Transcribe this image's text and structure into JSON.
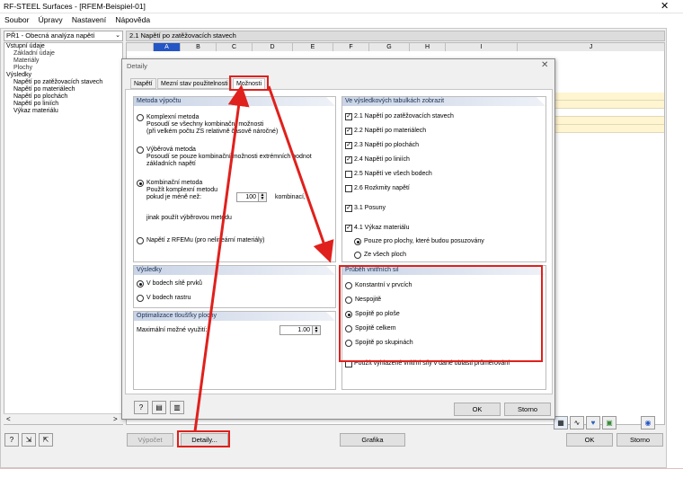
{
  "window": {
    "title": "RF-STEEL Surfaces - [RFEM-Beispiel-01]",
    "close_glyph": "✕"
  },
  "menu": [
    "Soubor",
    "Úpravy",
    "Nastavení",
    "Nápověda"
  ],
  "case_combo": {
    "value": "PŘ1 - Obecná analýza napětí",
    "arrow": "⌄"
  },
  "table_title": "2.1 Napětí po zatěžovacích stavech",
  "nav_tree": [
    {
      "label": "Vstupní údaje",
      "level": 0
    },
    {
      "label": "Základní údaje",
      "level": 1
    },
    {
      "label": "Materiály",
      "level": 1
    },
    {
      "label": "Plochy",
      "level": 1
    },
    {
      "label": "Výsledky",
      "level": 0
    },
    {
      "label": "Napětí po zatěžovacích stavech",
      "level": 1
    },
    {
      "label": "Napětí po materiálech",
      "level": 1
    },
    {
      "label": "Napětí po plochách",
      "level": 1
    },
    {
      "label": "Napětí po liniích",
      "level": 1
    },
    {
      "label": "Výkaz materiálu",
      "level": 1
    }
  ],
  "grid_columns": [
    "A",
    "B",
    "C",
    "D",
    "E",
    "F",
    "G",
    "H",
    "I",
    "J"
  ],
  "nav_scroll": {
    "left": "<",
    "right": ">"
  },
  "dialog": {
    "title": "Detaily",
    "close_glyph": "✕",
    "tabs": [
      "Napětí",
      "Mezní stav použitelnosti",
      "Možnosti"
    ],
    "active_tab": "Možnosti",
    "calc_method": {
      "header": "Metoda výpočtu",
      "options": [
        {
          "label": "Komplexní metoda",
          "desc1": "Posoudí se všechny kombinační možnosti",
          "desc2": "(při velkém počtu ZS relativně časově náročné)",
          "selected": false
        },
        {
          "label": "Výběrová metoda",
          "desc1": "Posoudí se pouze kombinační možnosti extrémních hodnot",
          "desc2": "základních napětí",
          "selected": false
        },
        {
          "label": "Kombinační metoda",
          "desc1": "Použít komplexní metodu",
          "desc2": "pokud je méně než:",
          "selected": true
        }
      ],
      "combo_count": "100",
      "combo_suffix": "kombinací,",
      "otherwise": "jinak použít výběrovou metodu",
      "rfem_option": "Napětí z RFEMu (pro nelineární materiály)"
    },
    "results": {
      "header": "Výsledky",
      "options": [
        {
          "label": "V bodech sítě prvků",
          "selected": true
        },
        {
          "label": "V bodech rastru",
          "selected": false
        }
      ]
    },
    "optimization": {
      "header": "Optimalizace tloušťky plochy",
      "max_label": "Maximální možné využití:",
      "max_value": "1.00"
    },
    "show_tables": {
      "header": "Ve výsledkových tabulkách zobrazit",
      "items": [
        {
          "label": "2.1 Napětí po zatěžovacích stavech",
          "checked": true
        },
        {
          "label": "2.2 Napětí po materiálech",
          "checked": true
        },
        {
          "label": "2.3 Napětí po plochách",
          "checked": true
        },
        {
          "label": "2.4 Napětí po liniích",
          "checked": true
        },
        {
          "label": "2.5 Napětí ve všech bodech",
          "checked": false
        },
        {
          "label": "2.6 Rozkmity napětí",
          "checked": false
        },
        {
          "label": "3.1 Posuny",
          "checked": true
        },
        {
          "label": "4.1 Výkaz materiálu",
          "checked": true
        }
      ],
      "sub_options": [
        {
          "label": "Pouze pro plochy, které budou posuzovány",
          "selected": true
        },
        {
          "label": "Ze všech ploch",
          "selected": false
        }
      ]
    },
    "internal_forces": {
      "header": "Průběh vnitřních sil",
      "options": [
        {
          "label": "Konstantní v prvcích",
          "selected": false
        },
        {
          "label": "Nespojitě",
          "selected": false
        },
        {
          "label": "Spojitě po ploše",
          "selected": true
        },
        {
          "label": "Spojitě celkem",
          "selected": false
        },
        {
          "label": "Spojitě po skupinách",
          "selected": false
        }
      ],
      "smoothing_label": "Použít vyhlazené vnitřní síly v dané oblasti průměrování",
      "smoothing_checked": false
    },
    "ok_label": "OK",
    "cancel_label": "Storno"
  },
  "main_buttons": {
    "calc_label": "Výpočet",
    "details_label": "Detaily...",
    "graphics_label": "Grafika",
    "ok_label": "OK",
    "cancel_label": "Storno"
  },
  "colors": {
    "annotation_red": "#e0201c",
    "active_col": "#2456c5",
    "group_header": "#c9d4e6"
  }
}
